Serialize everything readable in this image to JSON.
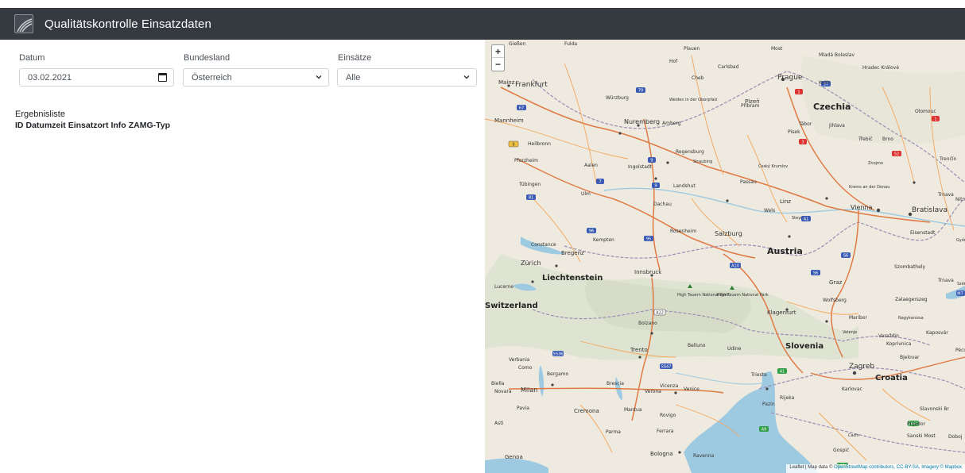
{
  "navbar": {
    "title": "Qualitätskontrolle Einsatzdaten"
  },
  "filters": {
    "datum": {
      "label": "Datum",
      "value": "03.02.2021"
    },
    "bundesland": {
      "label": "Bundesland",
      "value": "Österreich"
    },
    "einsaetze": {
      "label": "Einsätze",
      "value": "Alle"
    }
  },
  "results": {
    "title": "Ergebnisliste",
    "columns": [
      "ID",
      "Datumzeit",
      "Einsatzort",
      "Info",
      "ZAMG-Typ"
    ]
  },
  "map": {
    "zoom_in": "+",
    "zoom_out": "−",
    "labels": [
      {
        "text": "Gießen"
      },
      {
        "text": "Fulda"
      },
      {
        "text": "Plauen"
      },
      {
        "text": "Most"
      },
      {
        "text": "Mladá Boleslav"
      },
      {
        "text": "Hof"
      },
      {
        "text": "Carlsbad"
      },
      {
        "text": "Hradec Králové"
      },
      {
        "text": "Prague"
      },
      {
        "text": "Mainz"
      },
      {
        "text": "Frankfurt"
      },
      {
        "text": "Cheb"
      },
      {
        "text": "Kolín"
      },
      {
        "text": "Würzburg"
      },
      {
        "text": "Weiden in der Oberpfalz"
      },
      {
        "text": "Plzeň"
      },
      {
        "text": "Příbram"
      },
      {
        "text": "Czechia"
      },
      {
        "text": "Olomouc"
      },
      {
        "text": "Mannheim"
      },
      {
        "text": "Nuremberg"
      },
      {
        "text": "Amberg"
      },
      {
        "text": "Tábor"
      },
      {
        "text": "Jihlava"
      },
      {
        "text": "Písek"
      },
      {
        "text": "Heilbronn"
      },
      {
        "text": "Třebíč"
      },
      {
        "text": "Brno"
      },
      {
        "text": "Regensburg"
      },
      {
        "text": "Pforzheim"
      },
      {
        "text": "Aalen"
      },
      {
        "text": "Ingolstadt"
      },
      {
        "text": "Straubing"
      },
      {
        "text": "Český Krumlov"
      },
      {
        "text": "Znojmo"
      },
      {
        "text": "Trenčín"
      },
      {
        "text": "Tübingen"
      },
      {
        "text": "Landshut"
      },
      {
        "text": "Passau"
      },
      {
        "text": "Ulm"
      },
      {
        "text": "Krems an der Donau"
      },
      {
        "text": "Trnava"
      },
      {
        "text": "Nitra"
      },
      {
        "text": "Dachau"
      },
      {
        "text": "Linz"
      },
      {
        "text": "Vienna"
      },
      {
        "text": "Bratislava"
      },
      {
        "text": "Wels"
      },
      {
        "text": "Steyr"
      },
      {
        "text": "Kempten"
      },
      {
        "text": "Rosenheim"
      },
      {
        "text": "Salzburg"
      },
      {
        "text": "Eisenstadt"
      },
      {
        "text": "Győr"
      },
      {
        "text": "Constance"
      },
      {
        "text": "Bregenz"
      },
      {
        "text": "Austria"
      },
      {
        "text": "Zürich"
      },
      {
        "text": "Innsbruck"
      },
      {
        "text": "Szombathely"
      },
      {
        "text": "Liechtenstein"
      },
      {
        "text": "Graz"
      },
      {
        "text": "Székesf"
      },
      {
        "text": "Lucerne"
      },
      {
        "text": "High Tauern National Park"
      },
      {
        "text": "High Tauern National Park"
      },
      {
        "text": "Zalaegerszeg"
      },
      {
        "text": "Wolfsberg"
      },
      {
        "text": "Switzerland"
      },
      {
        "text": "Klagenfurt"
      },
      {
        "text": "Maribor"
      },
      {
        "text": "Nagykanizsa"
      },
      {
        "text": "Bolzano"
      },
      {
        "text": "Kaposvár"
      },
      {
        "text": "Velenje"
      },
      {
        "text": "Varaždin"
      },
      {
        "text": "Koprivnica"
      },
      {
        "text": "Belluno"
      },
      {
        "text": "Udine"
      },
      {
        "text": "Trento"
      },
      {
        "text": "Slovenia"
      },
      {
        "text": "Pécs"
      },
      {
        "text": "Verbania"
      },
      {
        "text": "Bjelovar"
      },
      {
        "text": "Como"
      },
      {
        "text": "Zagreb"
      },
      {
        "text": "Bergamo"
      },
      {
        "text": "Trieste"
      },
      {
        "text": "Croatia"
      },
      {
        "text": "Biella"
      },
      {
        "text": "Brescia"
      },
      {
        "text": "Vicenza"
      },
      {
        "text": "Novara"
      },
      {
        "text": "Milan"
      },
      {
        "text": "Verona"
      },
      {
        "text": "Venice"
      },
      {
        "text": "Karlovac"
      },
      {
        "text": "Rijeka"
      },
      {
        "text": "Pazin"
      },
      {
        "text": "Slavonski Br"
      },
      {
        "text": "Pavia"
      },
      {
        "text": "Cremona"
      },
      {
        "text": "Mantua"
      },
      {
        "text": "Rovigo"
      },
      {
        "text": "Prijedor"
      },
      {
        "text": "Asti"
      },
      {
        "text": "Parma"
      },
      {
        "text": "Ferrara"
      },
      {
        "text": "Cazin"
      },
      {
        "text": "Sanski Most"
      },
      {
        "text": "Doboj"
      },
      {
        "text": "Bologna"
      },
      {
        "text": "Ravenna"
      },
      {
        "text": "Genoa"
      },
      {
        "text": "Gospić"
      },
      {
        "text": "Trnava"
      }
    ],
    "attribution_prefix": "Leaflet | Map data ©",
    "attribution_osm": "OpenStreetMap contributors,",
    "attribution_license": "CC-BY-SA, Imagery © Mapbox"
  },
  "colors": {
    "navbar": "#343a40",
    "water": "#9ecae1",
    "road": "#f5a65b",
    "motorway": "#e07a45",
    "border": "#9b8db5"
  }
}
